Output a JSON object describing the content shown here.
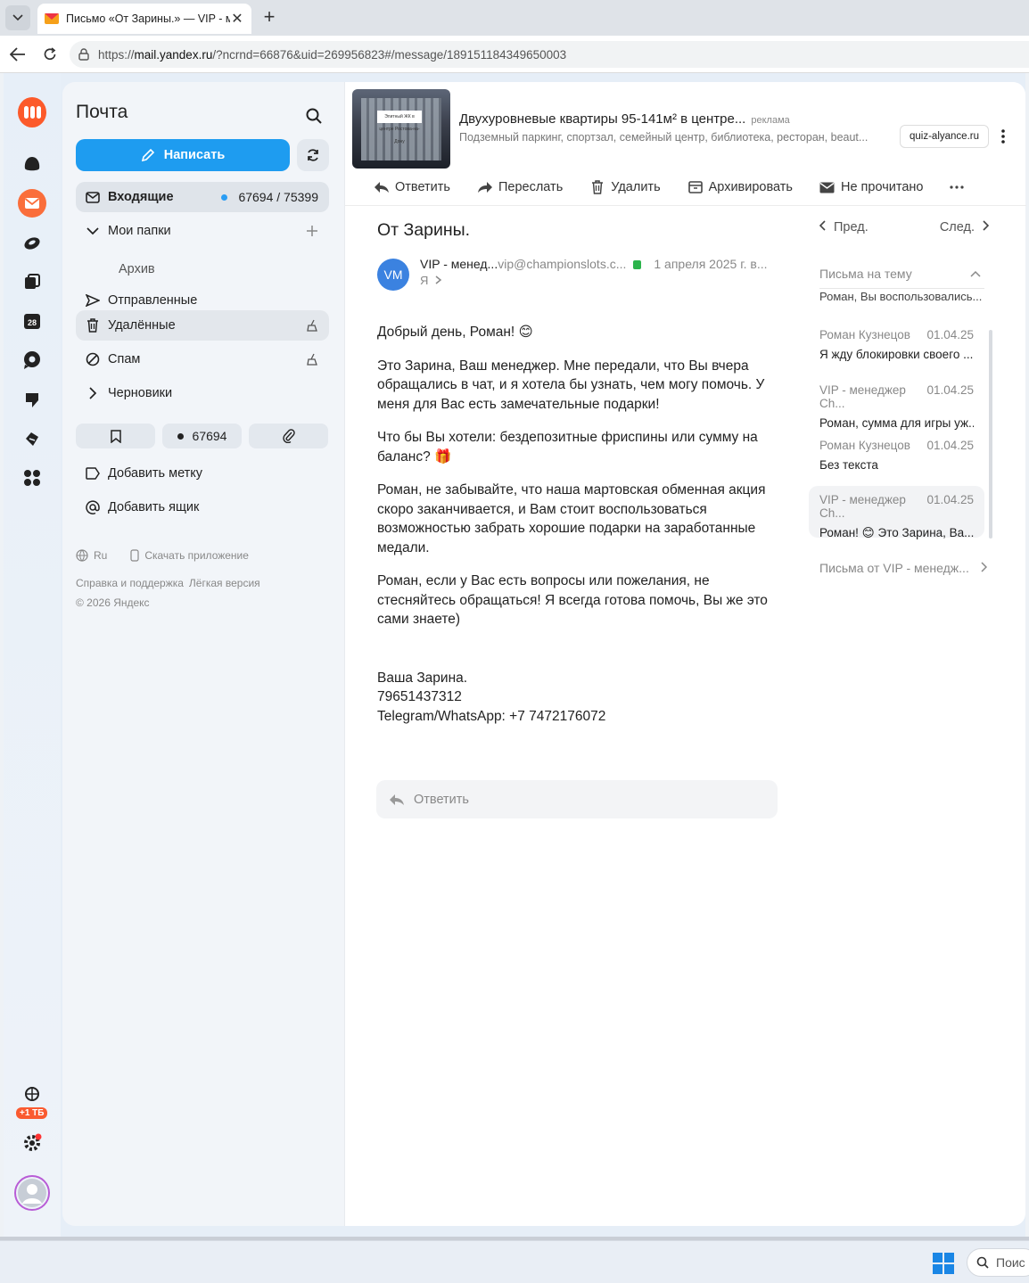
{
  "browser": {
    "tab_title": "Письмо «От Зарины.» — VIP - менеджер",
    "url_prefix": "https://",
    "url_host": "mail.yandex.ru",
    "url_rest": "/?ncrnd=66876&uid=269956823#/message/189151184349650003"
  },
  "sidebar": {
    "title": "Почта",
    "compose_label": "Написать",
    "folders": {
      "inbox": {
        "label": "Входящие",
        "unread": "67694",
        "total": "/ 75399"
      },
      "my_folders": "Мои папки",
      "archive": "Архив",
      "sent": "Отправленные",
      "deleted": "Удалённые",
      "spam": "Спам",
      "drafts": "Черновики"
    },
    "chips": {
      "unread_count": "67694"
    },
    "add_label": "Добавить метку",
    "add_box": "Добавить ящик",
    "footer": {
      "lang": "Ru",
      "download": "Скачать приложение",
      "help": "Справка и поддержка",
      "lite": "Лёгкая версия",
      "copyright": "© 2026 Яндекс"
    }
  },
  "rail": {
    "calendar_day": "28",
    "storage_badge": "+1 ТБ"
  },
  "ad": {
    "title": "Двухуровневые квартиры 95-141м² в центре...",
    "label": "реклама",
    "subtitle": "Подземный паркинг, спортзал, семейный центр, библиотека, ресторан, beaut...",
    "domain": "quiz-alyance.ru",
    "image_text": "Элитный ЖК в центре Ростова-на-Дону"
  },
  "toolbar": {
    "reply": "Ответить",
    "forward": "Переслать",
    "delete": "Удалить",
    "archive": "Архивировать",
    "unread": "Не прочитано"
  },
  "message": {
    "subject": "От Зарины.",
    "avatar": "VM",
    "sender_name": "VIP - менед...",
    "sender_email": "vip@championslots.c...",
    "date": "1 апреля 2025 г. в...",
    "to": "Я",
    "paragraphs": [
      "Добрый день, Роман! 😊",
      "Это Зарина, Ваш менеджер. Мне передали, что Вы вчера обращались в чат, и я хотела бы узнать, чем могу помочь. У меня для Вас есть замечательные подарки!",
      "Что бы Вы хотели: бездепозитные фриспины или сумму на баланс? 🎁",
      "Роман, не забывайте, что наша мартовская обменная акция скоро заканчивается, и Вам стоит воспользоваться возможностью забрать хорошие подарки на заработанные медали.",
      "Роман, если у Вас есть вопросы или пожелания, не стесняйтесь обращаться! Я всегда готова помочь, Вы же это сами знаете)"
    ],
    "signature": [
      "Ваша Зарина.",
      "79651437312",
      "Telegram/WhatsApp: +7 7472176072"
    ],
    "reply_placeholder": "Ответить"
  },
  "thread": {
    "prev": "Пред.",
    "next": "След.",
    "heading": "Письма на тему",
    "cut_item": "Роман, Вы воспользовались...",
    "items": [
      {
        "from": "Роман Кузнецов",
        "date": "01.04.25",
        "snippet": "Я жду блокировки своего ..."
      },
      {
        "from": "VIP - менеджер Ch...",
        "date": "01.04.25",
        "snippet": "Роман, сумма для игры уж..."
      },
      {
        "from": "Роман Кузнецов",
        "date": "01.04.25",
        "snippet": "Без текста"
      },
      {
        "from": "VIP - менеджер Ch...",
        "date": "01.04.25",
        "snippet": "Роман! 😊 Это Зарина, Ва..."
      }
    ],
    "from_link": "Письма от VIP - менедж..."
  },
  "taskbar": {
    "search": "Поис"
  },
  "colors": {
    "accent": "#1e9cf0",
    "brand": "#fc5a2b",
    "avatar": "#3b82e0"
  }
}
